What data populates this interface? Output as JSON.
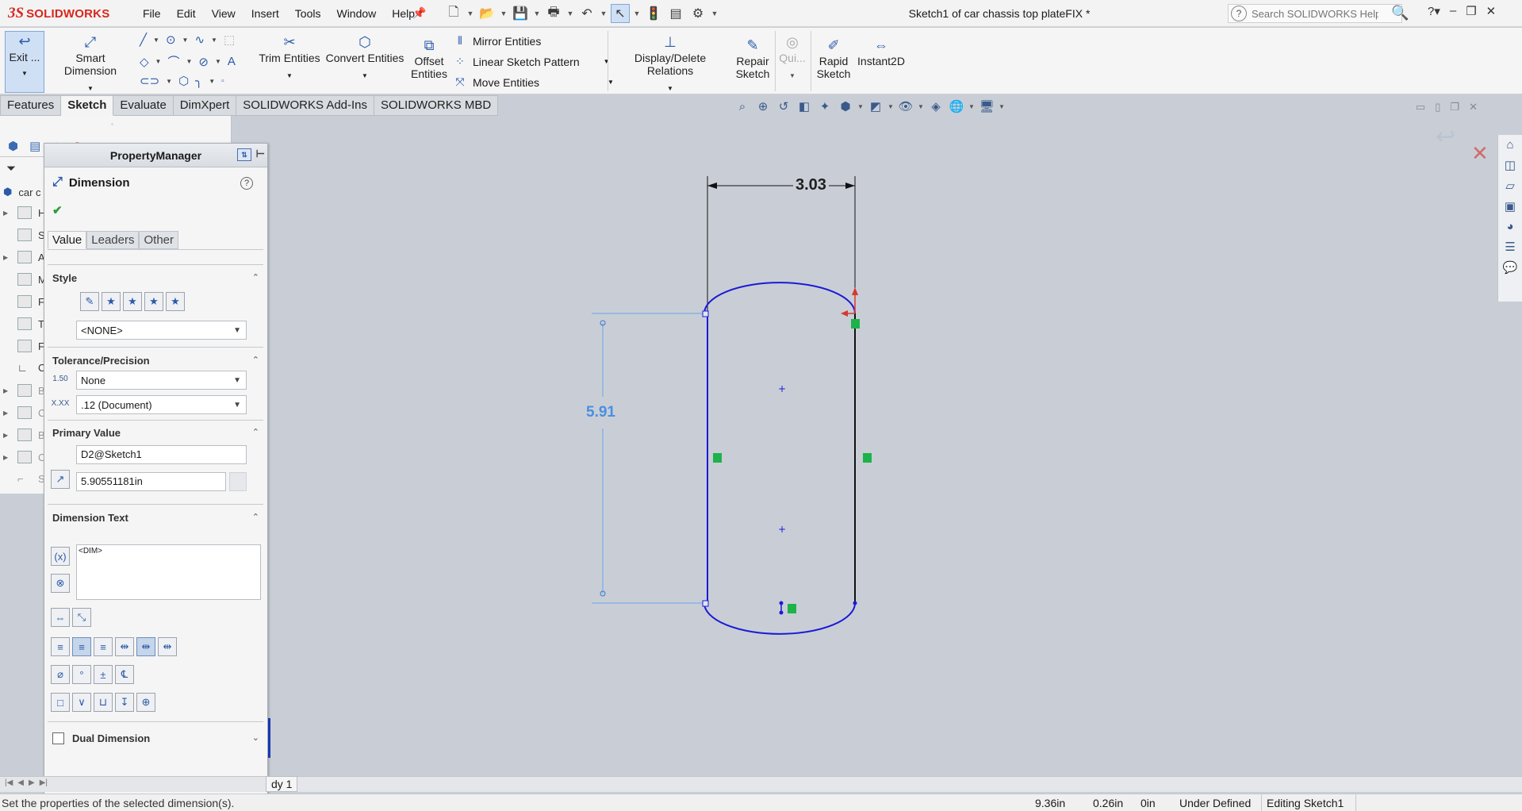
{
  "app": {
    "brand_ds": "3S",
    "brand_name": "SOLIDWORKS"
  },
  "menu": [
    "File",
    "Edit",
    "View",
    "Insert",
    "Tools",
    "Window",
    "Help"
  ],
  "document_title": "Sketch1 of car chassis top plateFIX *",
  "search": {
    "placeholder": "Search SOLIDWORKS Help"
  },
  "command_manager": {
    "exit_sketch": "Exit ...",
    "smart_dimension": "Smart Dimension",
    "trim_entities": "Trim Entities",
    "convert_entities": "Convert Entities",
    "offset_entities_1": "Offset",
    "offset_entities_2": "Entities",
    "mirror_entities": "Mirror Entities",
    "linear_sketch_pattern": "Linear Sketch Pattern",
    "move_entities": "Move Entities",
    "display_delete_relations": "Display/Delete Relations",
    "repair_sketch_1": "Repair",
    "repair_sketch_2": "Sketch",
    "quick_snaps": "Qui...",
    "rapid_sketch_1": "Rapid",
    "rapid_sketch_2": "Sketch",
    "instant2d": "Instant2D"
  },
  "tabs": [
    "Features",
    "Sketch",
    "Evaluate",
    "DimXpert",
    "SOLIDWORKS Add-Ins",
    "SOLIDWORKS MBD"
  ],
  "active_tab": "Sketch",
  "feature_tree": {
    "root_label": "car c",
    "rows": [
      "H",
      "S",
      "A",
      "M",
      "F",
      "T",
      "F",
      "C",
      "B",
      "C",
      "B",
      "C",
      "S"
    ]
  },
  "property_manager": {
    "header": "PropertyManager",
    "title": "Dimension",
    "tabs": [
      "Value",
      "Leaders",
      "Other"
    ],
    "style": {
      "label": "Style",
      "selected": "<NONE>"
    },
    "tolerance": {
      "label": "Tolerance/Precision",
      "tolerance_type": "None",
      "precision": ".12 (Document)",
      "tol_icon_text": "1.50",
      "prec_icon_text": "X.XX"
    },
    "primary_value": {
      "label": "Primary Value",
      "name": "D2@Sketch1",
      "value": "5.90551181in"
    },
    "dimension_text": {
      "label": "Dimension Text",
      "content": "<DIM>"
    },
    "dual_dimension": {
      "label": "Dual Dimension",
      "checked": false
    }
  },
  "sketch": {
    "horizontal_dim": "3.03",
    "vertical_dim": "5.91"
  },
  "model_tab": "dy 1",
  "status": {
    "message": "Set the properties of the selected dimension(s).",
    "x": "9.36in",
    "y": "0.26in",
    "z": "0in",
    "definition": "Under Defined",
    "editing": "Editing Sketch1"
  },
  "colors": {
    "sketch_blue": "#1a1ad6",
    "selected_dim": "#4a8fe0",
    "relation_green": "#1db24a",
    "brand_red": "#d9261c"
  }
}
